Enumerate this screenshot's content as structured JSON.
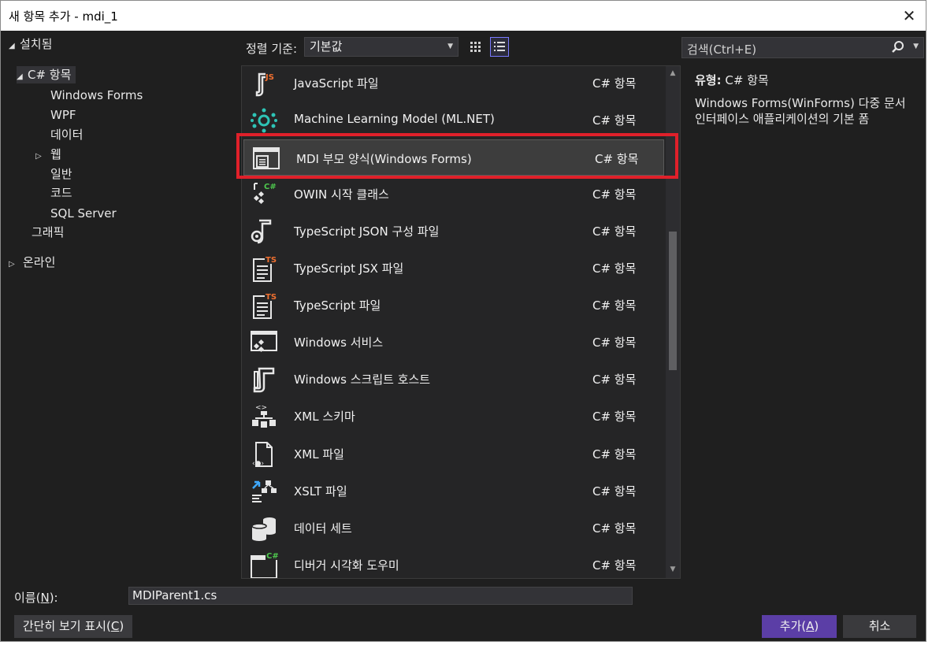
{
  "window": {
    "title": "새 항목 추가 - mdi_1",
    "close_glyph": "✕"
  },
  "tree": {
    "installed": "설치됨",
    "csharp_items": "C# 항목",
    "children": [
      "Windows Forms",
      "WPF",
      "데이터",
      "웹",
      "일반",
      "코드",
      "SQL Server"
    ],
    "graphics": "그래픽",
    "online": "온라인"
  },
  "sort": {
    "label": "정렬 기준:",
    "value": "기본값"
  },
  "items": [
    {
      "name": "JavaScript 파일",
      "category": "C# 항목",
      "icon": "javascript-file-icon"
    },
    {
      "name": "Machine Learning Model (ML.NET)",
      "category": "C# 항목",
      "icon": "ml-model-icon"
    },
    {
      "name": "MDI 부모 양식(Windows Forms)",
      "category": "C# 항목",
      "icon": "mdi-form-icon"
    },
    {
      "name": "OWIN 시작 클래스",
      "category": "C# 항목",
      "icon": "owin-class-icon"
    },
    {
      "name": "TypeScript JSON 구성 파일",
      "category": "C# 항목",
      "icon": "json-config-icon"
    },
    {
      "name": "TypeScript JSX 파일",
      "category": "C# 항목",
      "icon": "tsx-file-icon"
    },
    {
      "name": "TypeScript 파일",
      "category": "C# 항목",
      "icon": "ts-file-icon"
    },
    {
      "name": "Windows 서비스",
      "category": "C# 항목",
      "icon": "windows-service-icon"
    },
    {
      "name": "Windows 스크립트 호스트",
      "category": "C# 항목",
      "icon": "script-host-icon"
    },
    {
      "name": "XML 스키마",
      "category": "C# 항목",
      "icon": "xml-schema-icon"
    },
    {
      "name": "XML 파일",
      "category": "C# 항목",
      "icon": "xml-file-icon"
    },
    {
      "name": "XSLT 파일",
      "category": "C# 항목",
      "icon": "xslt-file-icon"
    },
    {
      "name": "데이터 세트",
      "category": "C# 항목",
      "icon": "dataset-icon"
    },
    {
      "name": "디버거 시각화 도우미",
      "category": "C# 항목",
      "icon": "debugger-visualizer-icon"
    }
  ],
  "selected_index": 2,
  "search": {
    "placeholder": "검색(Ctrl+E)"
  },
  "details": {
    "type_label": "유형:",
    "type_value": "C# 항목",
    "description": "Windows Forms(WinForms) 다중 문서 인터페이스 애플리케이션의 기본 폼"
  },
  "bottom": {
    "name_label": "이름(",
    "name_key": "N",
    "name_label_end": "):",
    "name_value": "MDIParent1.cs",
    "compact_label": "간단히 보기 표시(",
    "compact_key": "C",
    "compact_end": ")",
    "add_label": "추가(",
    "add_key": "A",
    "add_end": ")",
    "cancel": "취소"
  },
  "colors": {
    "accent": "#5b3ea6",
    "highlight": "#e0202a",
    "csharp_badge": "#4ec94e",
    "ts_badge": "#f07030"
  }
}
